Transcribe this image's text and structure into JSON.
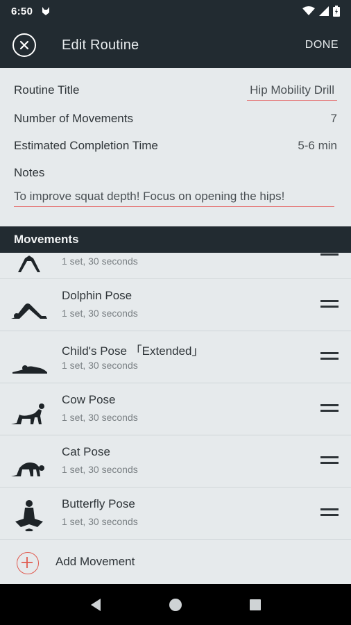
{
  "status_bar": {
    "time": "6:50"
  },
  "app_bar": {
    "title": "Edit Routine",
    "done_label": "DONE"
  },
  "details": {
    "routine_title_label": "Routine Title",
    "routine_title_value": "Hip Mobility Drill",
    "movements_count_label": "Number of Movements",
    "movements_count_value": "7",
    "completion_time_label": "Estimated Completion Time",
    "completion_time_value": "5-6 min",
    "notes_label": "Notes",
    "notes_value": "To improve squat depth! Focus on opening the hips!"
  },
  "movements_header": "Movements",
  "movements": [
    {
      "name": "",
      "detail": "1 set, 30 seconds",
      "icon": "standing-pose-icon"
    },
    {
      "name": "Dolphin Pose",
      "detail": "1 set, 30 seconds",
      "icon": "dolphin-pose-icon"
    },
    {
      "name": "Child's Pose 「Extended」",
      "detail": "1 set, 30 seconds",
      "icon": "childs-pose-icon"
    },
    {
      "name": "Cow Pose",
      "detail": "1 set, 30 seconds",
      "icon": "cow-pose-icon"
    },
    {
      "name": "Cat Pose",
      "detail": "1 set, 30 seconds",
      "icon": "cat-pose-icon"
    },
    {
      "name": "Butterfly Pose",
      "detail": "1 set, 30 seconds",
      "icon": "butterfly-pose-icon"
    }
  ],
  "add_movement_label": "Add Movement",
  "colors": {
    "dark": "#222b31",
    "background": "#e6eaec",
    "accent": "#e05a4f"
  }
}
